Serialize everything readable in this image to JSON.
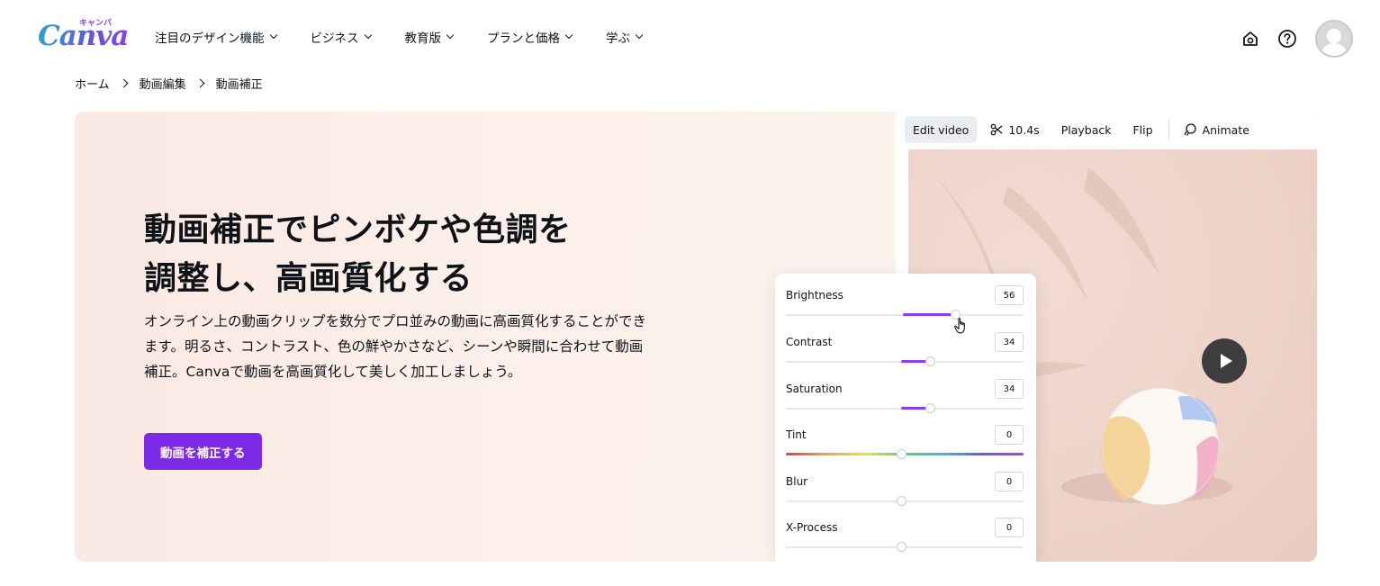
{
  "logo": {
    "kana": "キャンバ",
    "word": "Canva"
  },
  "nav": {
    "items": [
      {
        "label": "注目のデザイン機能"
      },
      {
        "label": "ビジネス"
      },
      {
        "label": "教育版"
      },
      {
        "label": "プランと価格"
      },
      {
        "label": "学ぶ"
      }
    ],
    "icons": [
      "home-icon",
      "help-icon",
      "avatar"
    ]
  },
  "breadcrumb": [
    "ホーム",
    "動画編集",
    "動画補正"
  ],
  "hero": {
    "title_line1": "動画補正でピンボケや色調を",
    "title_line2": "調整し、高画質化する",
    "description": "オンライン上の動画クリップを数分でプロ並みの動画に高画質化することができます。明るさ、コントラスト、色の鮮やかさなど、シーンや瞬間に合わせて動画補正。Canvaで動画を高画質化して美しく加工しましょう。",
    "cta_label": "動画を補正する"
  },
  "editor": {
    "toolbar": {
      "edit_video": "Edit video",
      "duration": "10.4s",
      "playback": "Playback",
      "flip": "Flip",
      "animate": "Animate"
    },
    "adjustments": [
      {
        "label": "Brightness",
        "value": "56",
        "level": 0.56
      },
      {
        "label": "Contrast",
        "value": "34",
        "level": 0.34
      },
      {
        "label": "Saturation",
        "value": "34",
        "level": 0.34
      },
      {
        "label": "Tint",
        "value": "0",
        "level": 0
      },
      {
        "label": "Blur",
        "value": "0",
        "level": 0
      },
      {
        "label": "X-Process",
        "value": "0",
        "level": 0
      }
    ]
  },
  "colors": {
    "accent": "#7d2ae8",
    "slider_fill": "#8b3dff",
    "hero_bg": "#fbe9e3"
  }
}
